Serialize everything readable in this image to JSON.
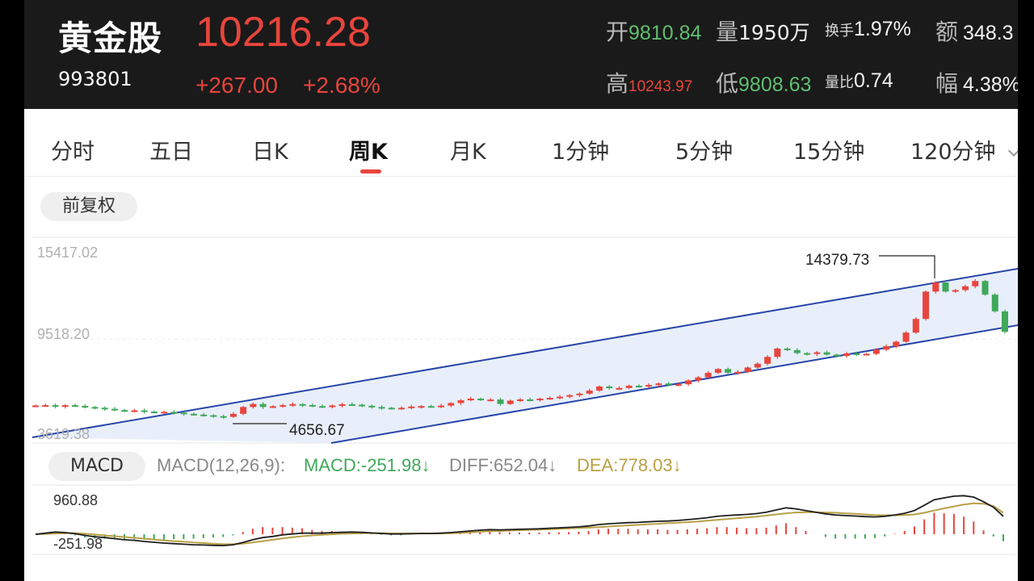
{
  "header": {
    "stock_name": "黄金股",
    "stock_code": "993801",
    "price": "10216.28",
    "change": "+267.00",
    "change_pct": "+2.68%",
    "open_label": "开",
    "open_value": "9810.84",
    "volume_label": "量",
    "volume_value": "1950万",
    "turnover_label": "换手",
    "turnover_value": "1.97%",
    "amount_label": "额",
    "amount_value": "348.3",
    "high_label": "高",
    "high_value": "10243.97",
    "low_label": "低",
    "low_value": "9808.63",
    "volume_ratio_label": "量比",
    "volume_ratio_value": "0.74",
    "amplitude_label": "幅",
    "amplitude_value": "4.38%"
  },
  "tabs": [
    {
      "label": "分时",
      "active": false
    },
    {
      "label": "五日",
      "active": false
    },
    {
      "label": "日K",
      "active": false
    },
    {
      "label": "周K",
      "active": true
    },
    {
      "label": "月K",
      "active": false
    },
    {
      "label": "1分钟",
      "active": false
    },
    {
      "label": "5分钟",
      "active": false
    },
    {
      "label": "15分钟",
      "active": false
    },
    {
      "label": "120分钟",
      "active": false
    }
  ],
  "adjustment_label": "前复权",
  "colors": {
    "up": "#e8453c",
    "down": "#3fa85a",
    "channel_line": "#2846a8",
    "channel_fill": "#e8effb",
    "dea_line": "#b8a046"
  },
  "kline": {
    "axis_top_label": "15417.02",
    "axis_mid_label": "9518.20",
    "axis_bottom_label": "3619.38",
    "annotation_high": "14379.73",
    "annotation_low": "4656.67",
    "y_range": [
      3619.38,
      15417.02
    ],
    "closes": [
      5400,
      5420,
      5330,
      5420,
      5370,
      5300,
      5250,
      5180,
      5100,
      5050,
      5080,
      5000,
      4950,
      4980,
      4930,
      4850,
      4800,
      4760,
      4700,
      4650,
      4850,
      5300,
      5500,
      5300,
      5350,
      5420,
      5490,
      5430,
      5360,
      5320,
      5400,
      5480,
      5450,
      5380,
      5300,
      5250,
      5200,
      5250,
      5330,
      5360,
      5320,
      5390,
      5560,
      5740,
      5850,
      5780,
      5790,
      5500,
      5720,
      5800,
      5780,
      5850,
      5900,
      5980,
      6080,
      6180,
      6380,
      6650,
      6550,
      6550,
      6700,
      6680,
      6750,
      6850,
      6750,
      6800,
      7050,
      7250,
      7550,
      7800,
      7560,
      7610,
      7900,
      8150,
      8600,
      9150,
      9050,
      8850,
      8800,
      8900,
      8750,
      8660,
      8830,
      8800,
      8800,
      9080,
      9300,
      9600,
      10200,
      11100,
      12900,
      13500,
      12900,
      13000,
      13250,
      13600,
      12700,
      11600,
      10250
    ]
  },
  "macd": {
    "legend_label": "MACD",
    "params": "MACD(12,26,9):",
    "macd_text": "MACD:-251.98",
    "diff_text": "DIFF:652.04",
    "dea_text": "DEA:778.03",
    "arrow_icon": "down-arrow",
    "axis_top_label": "960.88",
    "axis_bottom_label": "-251.98",
    "y_range": [
      -700,
      1700
    ],
    "diff": [
      0,
      40,
      80,
      60,
      20,
      -40,
      -90,
      -120,
      -160,
      -200,
      -220,
      -260,
      -290,
      -320,
      -340,
      -360,
      -380,
      -390,
      -400,
      -410,
      -380,
      -300,
      -200,
      -120,
      -80,
      -20,
      10,
      40,
      40,
      40,
      60,
      70,
      80,
      70,
      50,
      30,
      10,
      10,
      20,
      30,
      30,
      40,
      60,
      90,
      120,
      150,
      170,
      160,
      170,
      180,
      190,
      200,
      220,
      230,
      250,
      270,
      300,
      350,
      380,
      400,
      420,
      430,
      450,
      470,
      480,
      500,
      530,
      560,
      600,
      650,
      680,
      700,
      720,
      750,
      800,
      880,
      960,
      920,
      860,
      800,
      740,
      700,
      680,
      660,
      640,
      630,
      650,
      700,
      760,
      860,
      1050,
      1250,
      1320,
      1380,
      1400,
      1350,
      1180,
      980,
      652.04
    ],
    "dea": [
      0,
      10,
      30,
      40,
      40,
      20,
      -10,
      -40,
      -70,
      -100,
      -130,
      -160,
      -190,
      -220,
      -250,
      -270,
      -300,
      -320,
      -340,
      -360,
      -360,
      -340,
      -300,
      -250,
      -200,
      -150,
      -110,
      -70,
      -40,
      -20,
      0,
      20,
      30,
      40,
      40,
      40,
      30,
      30,
      30,
      30,
      30,
      30,
      40,
      50,
      70,
      90,
      110,
      120,
      135,
      150,
      160,
      170,
      180,
      195,
      210,
      225,
      240,
      260,
      280,
      300,
      320,
      340,
      360,
      380,
      400,
      420,
      440,
      460,
      490,
      520,
      550,
      580,
      610,
      640,
      680,
      720,
      760,
      790,
      800,
      800,
      790,
      780,
      760,
      740,
      720,
      700,
      690,
      690,
      700,
      720,
      780,
      860,
      940,
      1010,
      1080,
      1120,
      1110,
      1020,
      778.03
    ]
  }
}
